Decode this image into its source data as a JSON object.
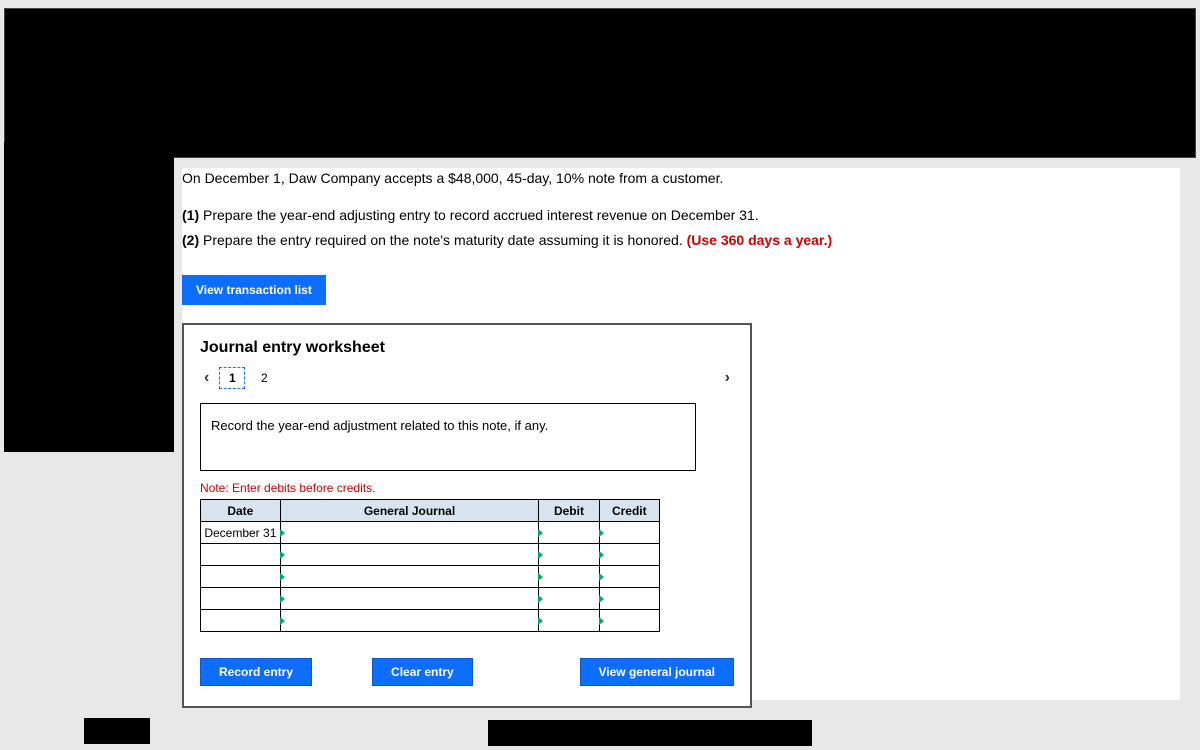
{
  "problem": {
    "intro": "On December 1, Daw Company accepts a $48,000, 45-day, 10% note from a customer.",
    "req1_prefix": "(1) ",
    "req1": "Prepare the year-end adjusting entry to record accrued interest revenue on December 31.",
    "req2_prefix": "(2) ",
    "req2": "Prepare the entry required on the note's maturity date assuming it is honored. ",
    "req2_red": "(Use 360 days a year.)"
  },
  "buttons": {
    "view_transaction_list": "View transaction list",
    "record_entry": "Record entry",
    "clear_entry": "Clear entry",
    "view_general_journal": "View general journal"
  },
  "worksheet": {
    "title": "Journal entry worksheet",
    "seq": {
      "active": "1",
      "next": "2"
    },
    "instruction": "Record the year-end adjustment related to this note, if any.",
    "note": "Note: Enter debits before credits.",
    "headers": {
      "date": "Date",
      "gj": "General Journal",
      "debit": "Debit",
      "credit": "Credit"
    },
    "rows": [
      {
        "date": "December 31",
        "gj": "",
        "debit": "",
        "credit": ""
      },
      {
        "date": "",
        "gj": "",
        "debit": "",
        "credit": ""
      },
      {
        "date": "",
        "gj": "",
        "debit": "",
        "credit": ""
      },
      {
        "date": "",
        "gj": "",
        "debit": "",
        "credit": ""
      },
      {
        "date": "",
        "gj": "",
        "debit": "",
        "credit": ""
      }
    ]
  }
}
